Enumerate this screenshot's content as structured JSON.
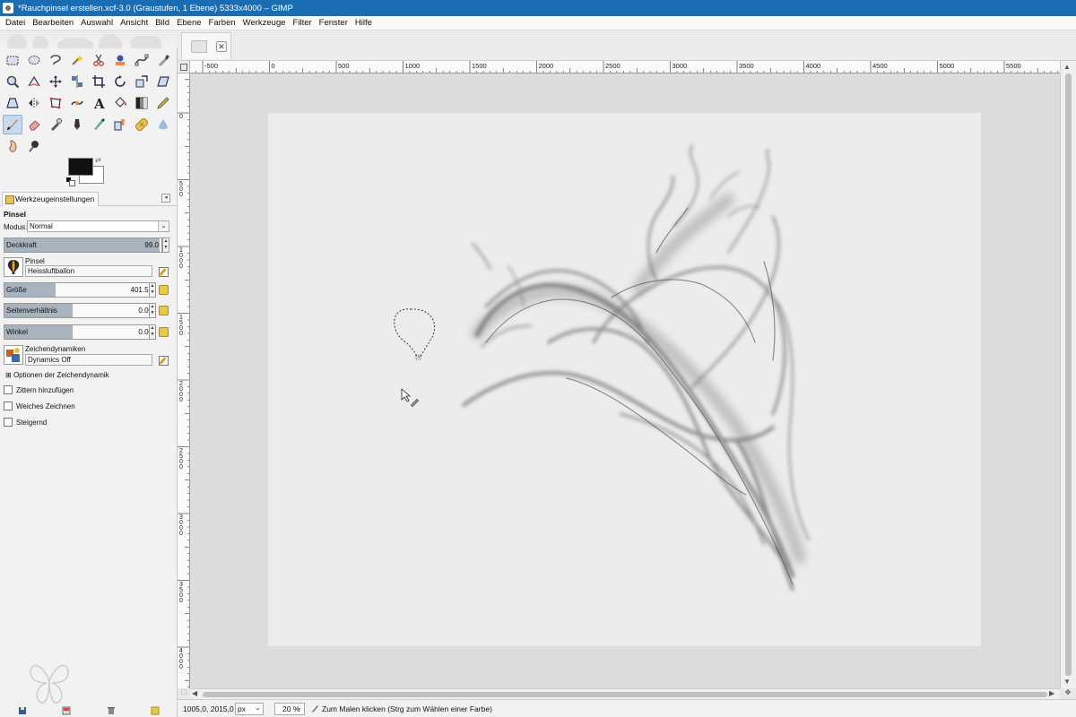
{
  "window": {
    "title": "*Rauchpinsel erstellen.xcf-3.0 (Graustufen, 1 Ebene) 5333x4000 – GIMP"
  },
  "menubar": [
    "Datei",
    "Bearbeiten",
    "Auswahl",
    "Ansicht",
    "Bild",
    "Ebene",
    "Farben",
    "Werkzeuge",
    "Filter",
    "Fenster",
    "Hilfe"
  ],
  "toolbox": {
    "tools": [
      "rect-select-icon",
      "ellipse-select-icon",
      "lasso-icon",
      "fuzzy-select-icon",
      "scissors-icon",
      "foreground-select-icon",
      "paths-icon",
      "color-picker-icon",
      "zoom-icon",
      "measure-icon",
      "move-icon",
      "align-icon",
      "crop-icon",
      "rotate-icon",
      "scale-icon",
      "shear-icon",
      "perspective-icon",
      "flip-icon",
      "cage-icon",
      "warp-icon",
      "text-icon",
      "bucket-fill-icon",
      "gradient-icon",
      "pencil-icon",
      "paintbrush-icon",
      "eraser-icon",
      "airbrush-icon",
      "ink-icon",
      "mypaint-icon",
      "clone-icon",
      "heal-icon",
      "blur-icon",
      "smudge-icon",
      "dodge-burn-icon"
    ],
    "active_tool_index": 24,
    "colors": {
      "foreground": "#111111",
      "background": "#ffffff"
    }
  },
  "tool_options": {
    "tab_label": "Werkzeugeinstellungen",
    "heading": "Pinsel",
    "mode_label": "Modus:",
    "mode_value": "Normal",
    "opacity": {
      "label": "Deckkraft",
      "value": "99.0",
      "fraction": 0.99
    },
    "brush": {
      "label": "Pinsel",
      "value": "Heissluftballon"
    },
    "size": {
      "label": "Größe",
      "value": "401.52",
      "fraction": 0.34
    },
    "aspect": {
      "label": "Seitenverhältnis",
      "value": "0.00",
      "fraction": 0.45
    },
    "angle": {
      "label": "Winkel",
      "value": "0.00",
      "fraction": 0.45
    },
    "dynamics": {
      "label": "Zeichendynamiken",
      "value": "Dynamics Off"
    },
    "dynamics_options_label": "Optionen der Zeichendynamik",
    "checkboxes": [
      {
        "label": "Zittern hinzufügen",
        "checked": false
      },
      {
        "label": "Weiches Zeichnen",
        "checked": false
      },
      {
        "label": "Steigernd",
        "checked": false
      }
    ]
  },
  "rulers": {
    "horizontal": [
      "-500",
      "0",
      "500",
      "1000",
      "1500",
      "2000",
      "2500",
      "3000",
      "3500",
      "4000",
      "4500",
      "5000",
      "5500"
    ],
    "vertical": [
      "0",
      "500",
      "1000",
      "1500",
      "2000",
      "2500",
      "3000",
      "3500",
      "4000"
    ]
  },
  "statusbar": {
    "coordinates": "1005,0, 2015,0",
    "unit": "px",
    "zoom": "20 %",
    "message": "Zum Malen klicken (Strg zum Wählen einer Farbe)"
  }
}
